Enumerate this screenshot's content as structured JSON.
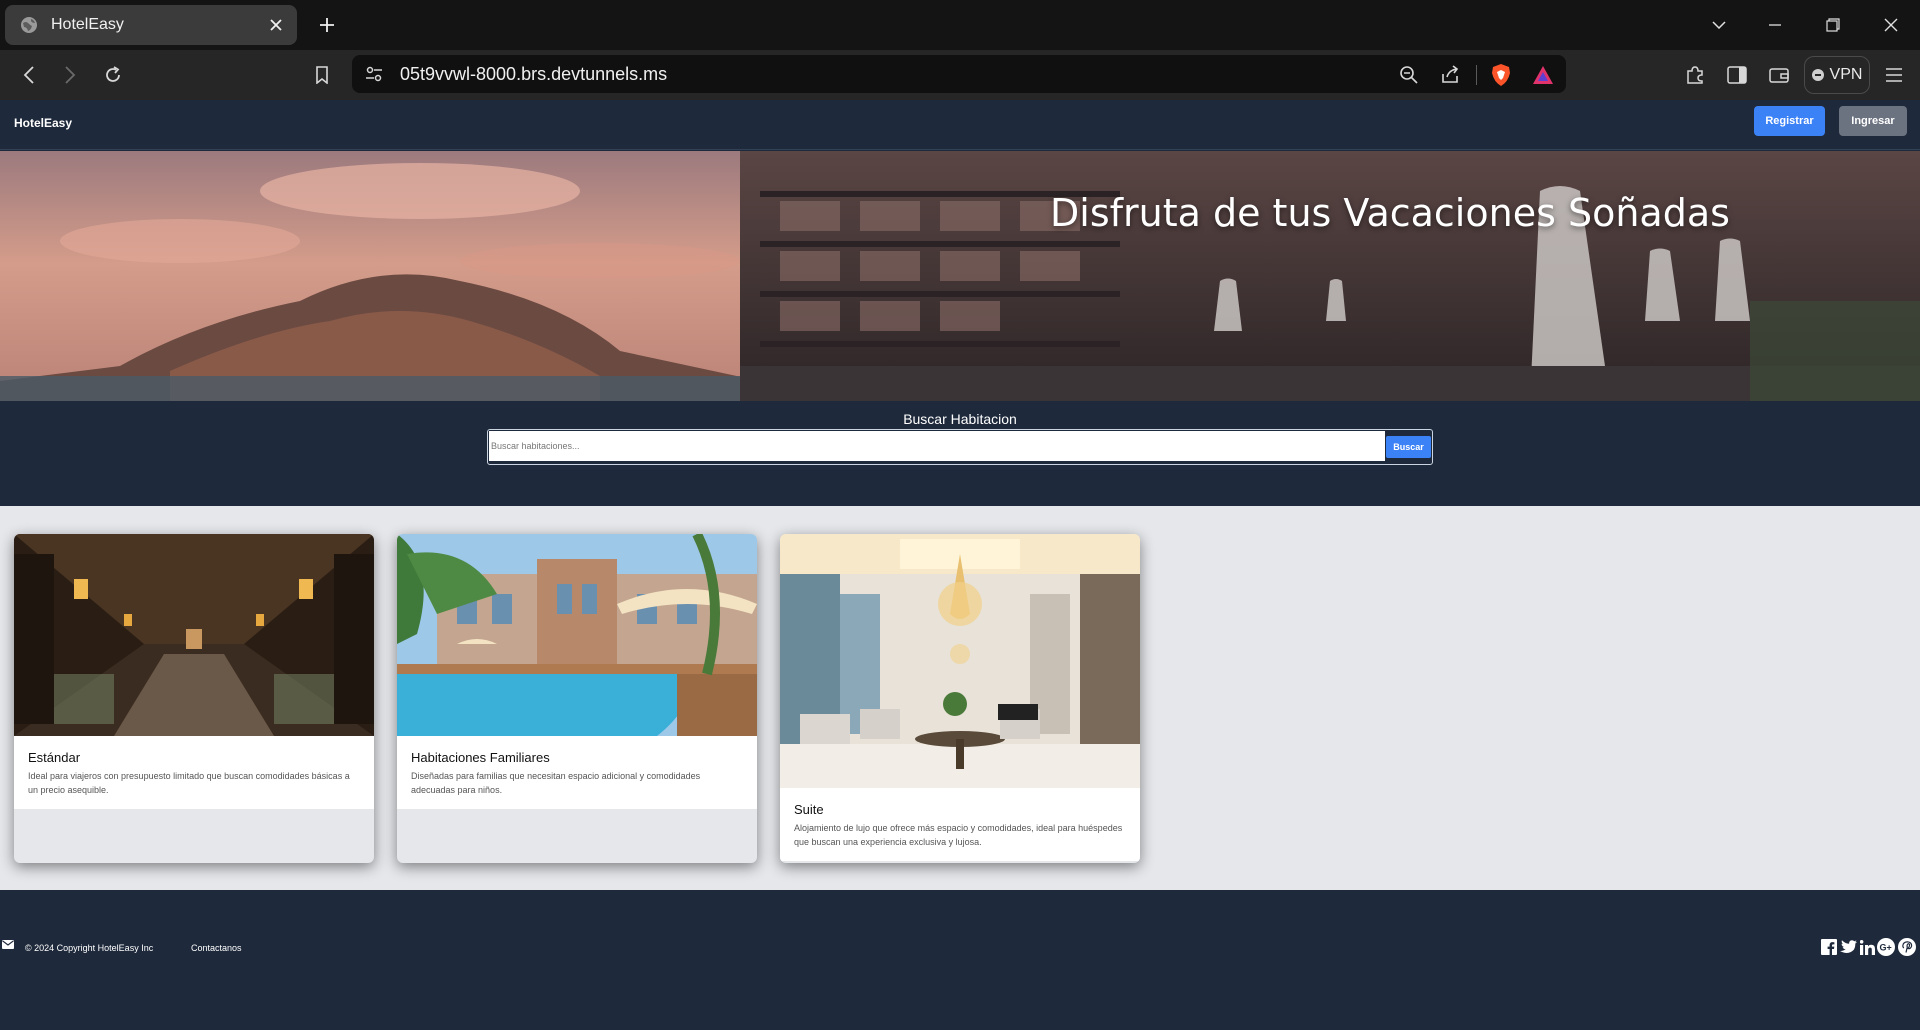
{
  "browser": {
    "tab_title": "HotelEasy",
    "url": "05t9vvwl-8000.brs.devtunnels.ms",
    "vpn_label": "VPN"
  },
  "header": {
    "brand": "HotelEasy",
    "register_label": "Registrar",
    "login_label": "Ingresar"
  },
  "hero": {
    "title": "Disfruta de tus Vacaciones Soñadas"
  },
  "search": {
    "label": "Buscar Habitacion",
    "placeholder": "Buscar habitaciones...",
    "button_label": "Buscar"
  },
  "rooms": [
    {
      "title": "Estándar",
      "description": "Ideal para viajeros con presupuesto limitado que buscan comodidades básicas a un precio asequible."
    },
    {
      "title": "Habitaciones Familiares",
      "description": "Diseñadas para familias que necesitan espacio adicional y comodidades adecuadas para niños."
    },
    {
      "title": "Suite",
      "description": "Alojamiento de lujo que ofrece más espacio y comodidades, ideal para huéspedes que buscan una experiencia exclusiva y lujosa."
    }
  ],
  "footer": {
    "copyright": "© 2024 Copyright HotelEasy Inc",
    "contact_label": "Contactanos",
    "social_icons": [
      "facebook-icon",
      "twitter-icon",
      "linkedin-icon",
      "google-plus-icon",
      "pinterest-icon"
    ]
  },
  "colors": {
    "page_dark": "#1e293b",
    "accent_blue": "#3b82f6",
    "button_gray": "#6b7280",
    "cards_background": "#e5e7eb"
  }
}
